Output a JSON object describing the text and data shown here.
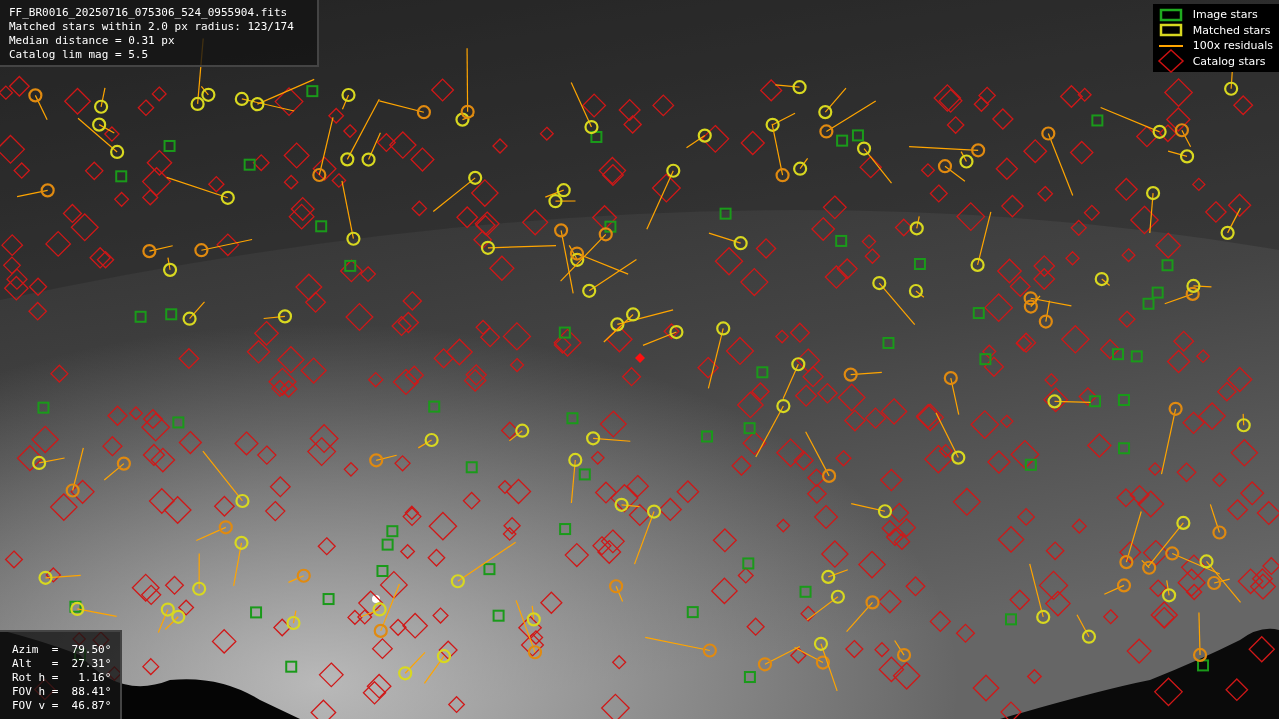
{
  "image_info": {
    "lines": [
      "FF_BR0016_20250716_075306_524_0955904.fits",
      "Matched stars within 2.0 px radius: 123/174",
      "Median distance = 0.31 px",
      "Catalog lim mag = 5.5"
    ]
  },
  "legend": [
    {
      "kind": "square",
      "label": "Image stars",
      "color": "#1faa1f"
    },
    {
      "kind": "square",
      "label": "Matched stars",
      "color": "#d8d820"
    },
    {
      "kind": "line",
      "label": "100x residuals",
      "color": "#ffa500"
    },
    {
      "kind": "diamond",
      "label": "Catalog stars",
      "color": "#cc1111"
    }
  ],
  "pointing": {
    "lines": [
      "Azim  =  79.50°",
      "Alt   =  27.31°",
      "Rot h =   1.16°",
      "FOV h =  88.41°",
      "FOV v =  46.87°"
    ]
  }
}
